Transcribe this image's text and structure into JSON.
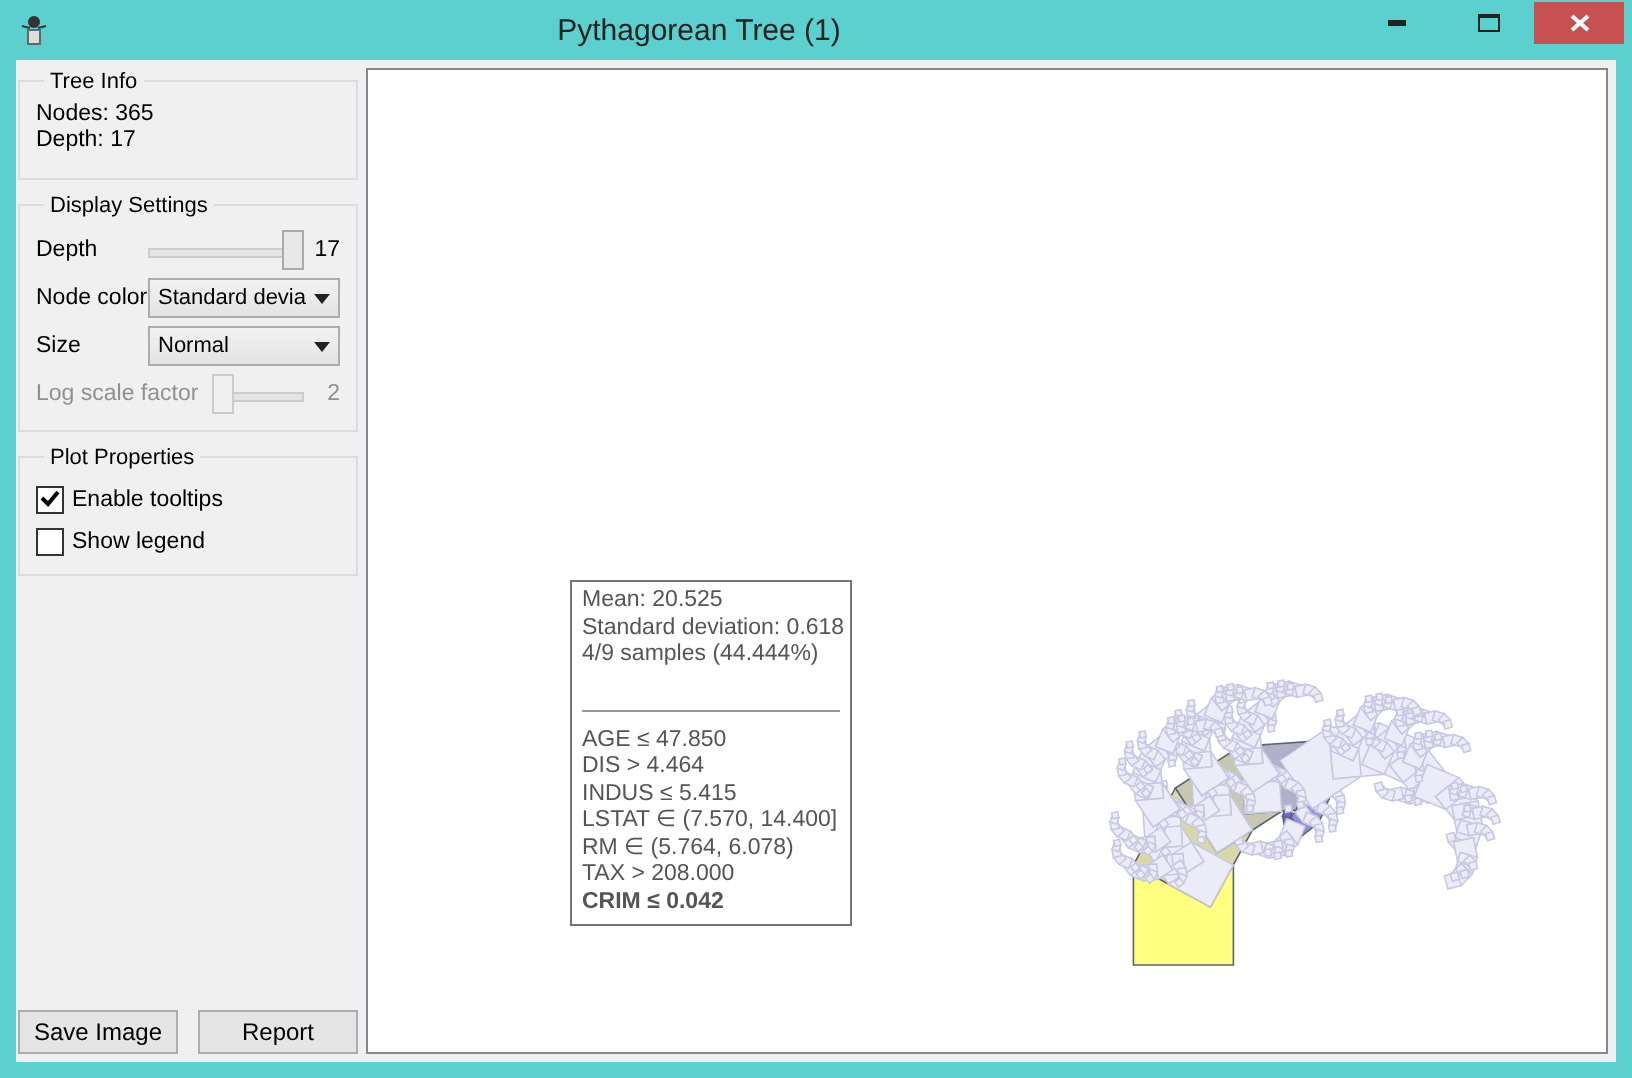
{
  "window": {
    "title": "Pythagorean Tree (1)"
  },
  "tree_info": {
    "title": "Tree Info",
    "lines": [
      "Nodes: 365",
      "Depth: 17"
    ]
  },
  "display_settings": {
    "title": "Display Settings",
    "depth": {
      "label": "Depth",
      "level": 1.0,
      "reading": "17",
      "disabled": false
    },
    "node_color": {
      "label": "Node color",
      "value": "Standard devia"
    },
    "size": {
      "label": "Size",
      "value": "Normal"
    },
    "log_scale": {
      "label": "Log scale factor",
      "level": 0.0,
      "reading": "2",
      "disabled": true
    }
  },
  "plot_properties": {
    "title": "Plot Properties",
    "options": [
      {
        "label": "Enable tooltips",
        "checked": true
      },
      {
        "label": "Show legend",
        "checked": false
      }
    ]
  },
  "buttons": [
    "Save Image",
    "Report"
  ],
  "tooltip": {
    "summary": [
      "Mean: 20.525",
      "Standard deviation: 0.618",
      "4/9 samples (44.444%)"
    ],
    "rules": [
      {
        "text": "AGE ≤ 47.850",
        "emphasized": false
      },
      {
        "text": "DIS > 4.464",
        "emphasized": false
      },
      {
        "text": "INDUS ≤ 5.415",
        "emphasized": false
      },
      {
        "text": "LSTAT ∈ (7.570, 14.400]",
        "emphasized": false
      },
      {
        "text": "RM ∈ (5.764, 6.078)",
        "emphasized": false
      },
      {
        "text": "TAX > 208.000",
        "emphasized": false
      },
      {
        "text": "CRIM ≤ 0.042",
        "emphasized": true
      }
    ]
  }
}
